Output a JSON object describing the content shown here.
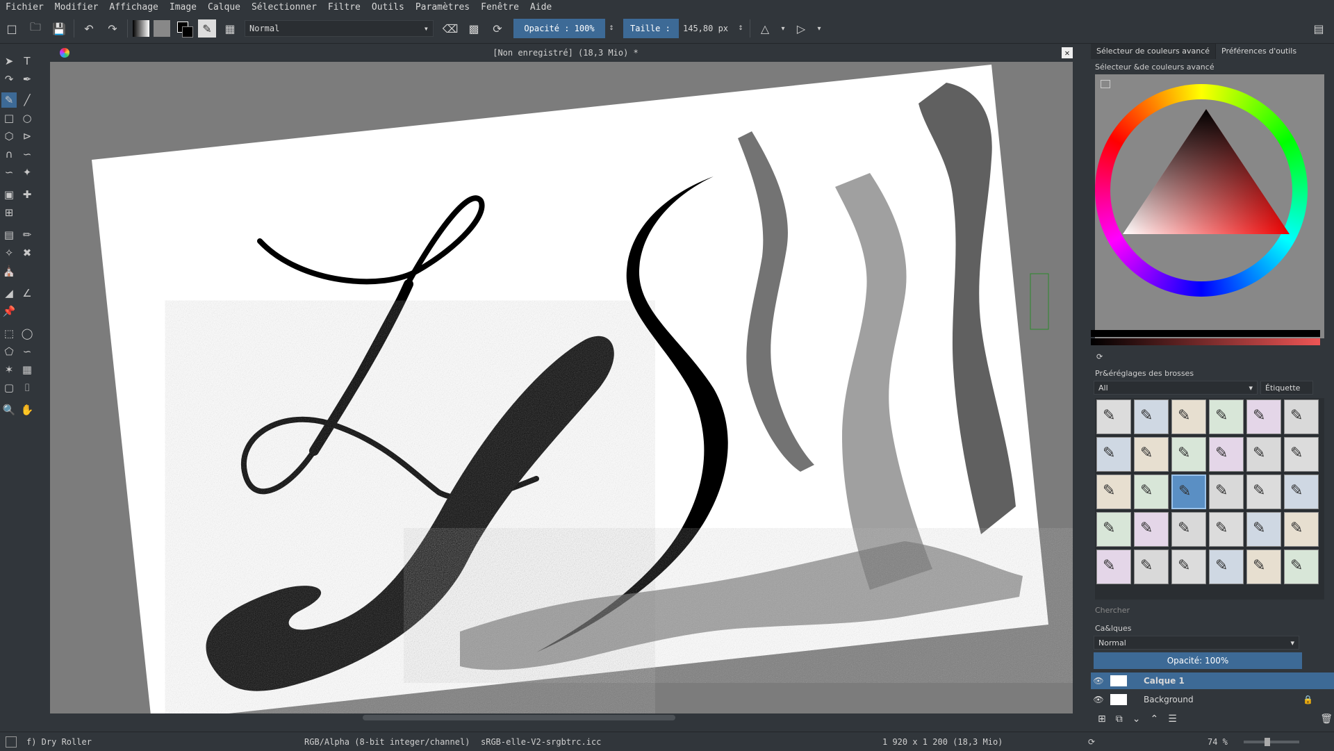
{
  "menu": [
    "Fichier",
    "Modifier",
    "Affichage",
    "Image",
    "Calque",
    "Sélectionner",
    "Filtre",
    "Outils",
    "Paramètres",
    "Fenêtre",
    "Aide"
  ],
  "toolbar": {
    "blend_mode": "Normal",
    "opacity_label": "Opacité : 100%",
    "size_label": "Taille :",
    "size_value": "145,80 px"
  },
  "document": {
    "title": "[Non enregistré]  (18,3 Mio) *"
  },
  "dock": {
    "tab_color": "Sélecteur de couleurs avancé",
    "tab_tools": "Préférences d'outils",
    "color_panel_title": "Sélecteur &de couleurs avancé",
    "brushes_title": "Pr&éréglages des brosses",
    "brush_filter": "All",
    "tag_label": "Étiquette",
    "search_placeholder": "Chercher",
    "layers_title": "Ca&lques",
    "layer_blend": "Normal",
    "layer_opacity": "Opacité:  100%",
    "layers": [
      "Calque 1",
      "Background"
    ]
  },
  "status": {
    "brush": "f) Dry Roller",
    "colorspace": "RGB/Alpha (8-bit integer/channel)",
    "profile": "sRGB-elle-V2-srgbtrc.icc",
    "dimensions": "1 920 x 1 200 (18,3 Mio)",
    "zoom": "74 %"
  },
  "colors": {
    "accent": "#3d6a96",
    "bg": "#31363b",
    "canvas_bg": "#7c7c7c"
  }
}
